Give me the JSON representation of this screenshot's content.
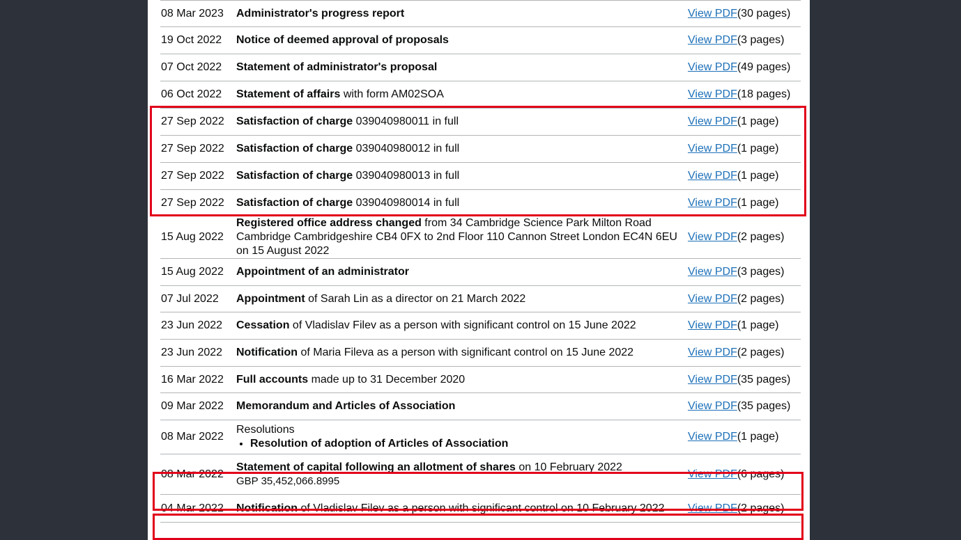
{
  "filings": [
    {
      "date": "08 Mar 2023",
      "title": "Administrator's progress report",
      "detail": "",
      "link": "View PDF",
      "pages": "(30 pages)"
    },
    {
      "date": "19 Oct 2022",
      "title": "Notice of deemed approval of proposals",
      "detail": "",
      "link": "View PDF",
      "pages": "(3 pages)"
    },
    {
      "date": "07 Oct 2022",
      "title": "Statement of administrator's proposal",
      "detail": "",
      "link": "View PDF",
      "pages": "(49 pages)"
    },
    {
      "date": "06 Oct 2022",
      "title": "Statement of affairs",
      "detail": " with form AM02SOA",
      "link": "View PDF",
      "pages": "(18 pages)"
    },
    {
      "date": "27 Sep 2022",
      "title": "Satisfaction of charge",
      "detail": " 039040980011 in full",
      "link": "View PDF",
      "pages": "(1 page)"
    },
    {
      "date": "27 Sep 2022",
      "title": "Satisfaction of charge",
      "detail": " 039040980012 in full",
      "link": "View PDF",
      "pages": "(1 page)"
    },
    {
      "date": "27 Sep 2022",
      "title": "Satisfaction of charge",
      "detail": " 039040980013 in full",
      "link": "View PDF",
      "pages": "(1 page)"
    },
    {
      "date": "27 Sep 2022",
      "title": "Satisfaction of charge",
      "detail": " 039040980014 in full",
      "link": "View PDF",
      "pages": "(1 page)"
    },
    {
      "date": "15 Aug 2022",
      "title": "Registered office address changed",
      "detail": " from 34 Cambridge Science Park Milton Road Cambridge Cambridgeshire CB4 0FX to 2nd Floor 110 Cannon Street London EC4N 6EU on 15 August 2022",
      "link": "View PDF",
      "pages": "(2 pages)"
    },
    {
      "date": "15 Aug 2022",
      "title": "Appointment of an administrator",
      "detail": "",
      "link": "View PDF",
      "pages": "(3 pages)"
    },
    {
      "date": "07 Jul 2022",
      "title": "Appointment",
      "detail": " of Sarah Lin as a director on 21 March 2022",
      "link": "View PDF",
      "pages": "(2 pages)"
    },
    {
      "date": "23 Jun 2022",
      "title": "Cessation",
      "detail": " of Vladislav Filev as a person with significant control on 15 June 2022",
      "link": "View PDF",
      "pages": "(1 page)"
    },
    {
      "date": "23 Jun 2022",
      "title": "Notification",
      "detail": " of Maria Fileva as a person with significant control on 15 June 2022",
      "link": "View PDF",
      "pages": "(2 pages)"
    },
    {
      "date": "16 Mar 2022",
      "title": "Full accounts",
      "detail": " made up to 31 December 2020",
      "link": "View PDF",
      "pages": "(35 pages)"
    },
    {
      "date": "09 Mar 2022",
      "title": "Memorandum and Articles of Association",
      "detail": "",
      "link": "View PDF",
      "pages": "(35 pages)"
    },
    {
      "date": "08 Mar 2022",
      "resolutions": true,
      "title": "Resolutions",
      "bullet": "Resolution of adoption of Articles of Association",
      "link": "View PDF",
      "pages": "(1 page)"
    },
    {
      "date": "08 Mar 2022",
      "title": "Statement of capital following an allotment of shares",
      "detail": " on 10 February 2022",
      "extra": "GBP 35,452,066.8995",
      "link": "View PDF",
      "pages": "(6 pages)"
    },
    {
      "date": "04 Mar 2022",
      "title": "Notification",
      "detail": " of Vladislav Filev as a person with significant control on 10 February 2022",
      "link": "View PDF",
      "pages": "(2 pages)"
    }
  ],
  "highlight_color": "#e1001a",
  "link_color": "#1d70b8"
}
